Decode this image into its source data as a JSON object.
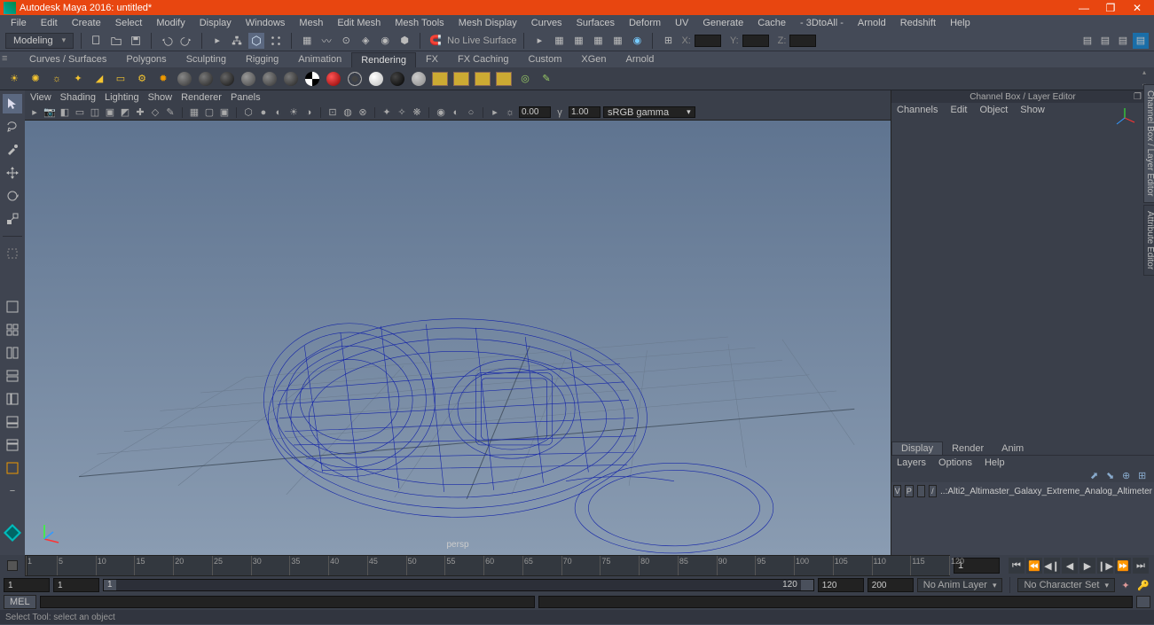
{
  "title": "Autodesk Maya 2016: untitled*",
  "menu": [
    "File",
    "Edit",
    "Create",
    "Select",
    "Modify",
    "Display",
    "Windows",
    "Mesh",
    "Edit Mesh",
    "Mesh Tools",
    "Mesh Display",
    "Curves",
    "Surfaces",
    "Deform",
    "UV",
    "Generate",
    "Cache",
    "- 3DtoAll -",
    "Arnold",
    "Redshift",
    "Help"
  ],
  "workspace": "Modeling",
  "noLive": "No Live Surface",
  "coord": {
    "x": "X:",
    "y": "Y:",
    "z": "Z:"
  },
  "shelf_tabs": [
    "Curves / Surfaces",
    "Polygons",
    "Sculpting",
    "Rigging",
    "Animation",
    "Rendering",
    "FX",
    "FX Caching",
    "Custom",
    "XGen",
    "Arnold"
  ],
  "shelf_active": 5,
  "panel_menu": [
    "View",
    "Shading",
    "Lighting",
    "Show",
    "Renderer",
    "Panels"
  ],
  "pt_field1": "0.00",
  "pt_field2": "1.00",
  "colorspace": "sRGB gamma",
  "persp": "persp",
  "right_header": "Channel Box / Layer Editor",
  "right_menu": [
    "Channels",
    "Edit",
    "Object",
    "Show"
  ],
  "layer_tabs": [
    "Display",
    "Render",
    "Anim"
  ],
  "layer_menu": [
    "Layers",
    "Options",
    "Help"
  ],
  "layer_row": {
    "v": "V",
    "p": "P",
    "slash": "/",
    "name": "..:Alti2_Altimaster_Galaxy_Extreme_Analog_Altimeter"
  },
  "timeline": {
    "start": 1,
    "end": 120,
    "ticks": [
      1,
      5,
      10,
      15,
      20,
      25,
      30,
      35,
      40,
      45,
      50,
      55,
      60,
      65,
      70,
      75,
      80,
      85,
      90,
      95,
      100,
      105,
      110,
      115,
      120
    ]
  },
  "range": {
    "f1": "1",
    "f2": "1",
    "f3": "120",
    "f4": "200",
    "s1": "1",
    "s2": "120"
  },
  "anim_layer": "No Anim Layer",
  "char_set": "No Character Set",
  "cmd": "MEL",
  "help": "Select Tool: select an object",
  "sidetabs": [
    "Channel Box / Layer Editor",
    "Attribute Editor"
  ]
}
